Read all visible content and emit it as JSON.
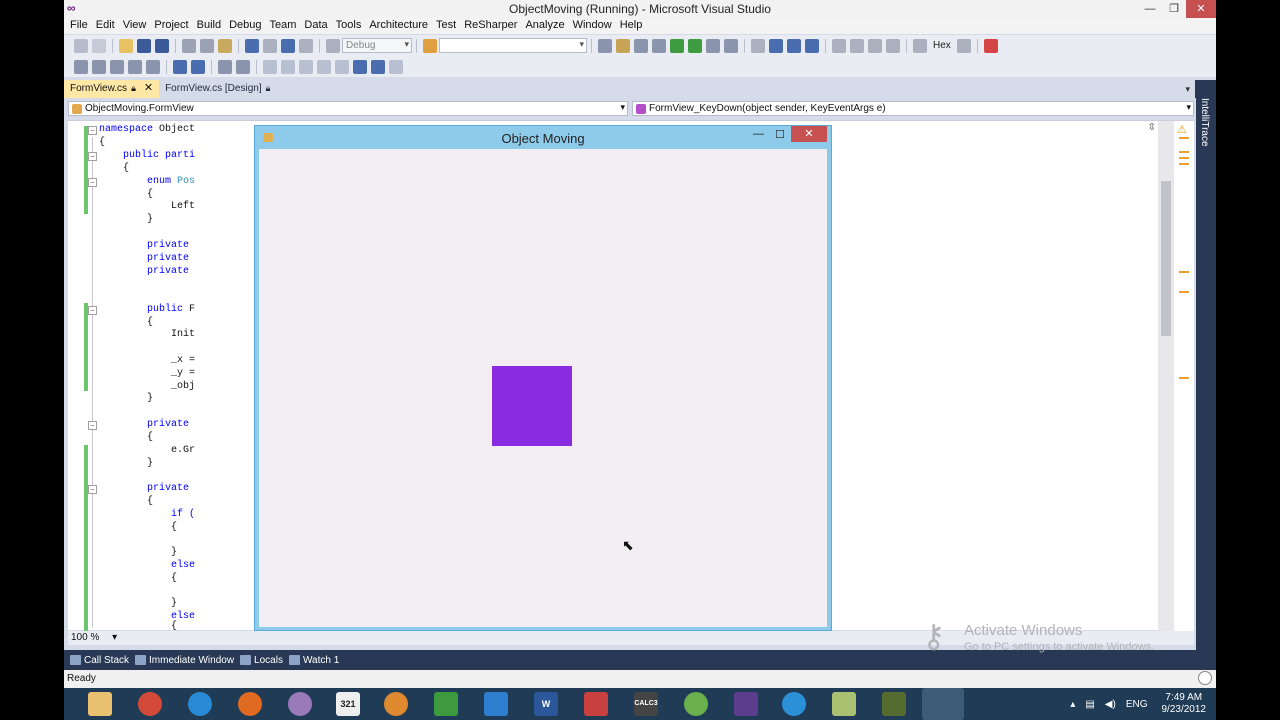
{
  "window": {
    "title": "ObjectMoving (Running) - Microsoft Visual Studio"
  },
  "menu": [
    "File",
    "Edit",
    "View",
    "Project",
    "Build",
    "Debug",
    "Team",
    "Data",
    "Tools",
    "Architecture",
    "Test",
    "ReSharper",
    "Analyze",
    "Window",
    "Help"
  ],
  "toolbar": {
    "config_combo": "Debug",
    "platform_combo": "",
    "hex_label": "Hex"
  },
  "tabs": {
    "active": "FormView.cs",
    "inactive": "FormView.cs [Design]"
  },
  "navbar": {
    "class_combo": "ObjectMoving.FormView",
    "member_combo": "FormView_KeyDown(object sender, KeyEventArgs e)"
  },
  "code": {
    "l1": "namespace Object",
    "l2": "{",
    "l3": "    public parti",
    "l4": "    {",
    "l5": "        enum Pos",
    "l6": "        {",
    "l7": "            Left",
    "l8": "        }",
    "l9": "        private",
    "l10": "        private",
    "l11": "        private",
    "l12": "        public F",
    "l13": "        {",
    "l14": "            Init",
    "l15": "            _x =",
    "l16": "            _y =",
    "l17": "            _obj",
    "l18": "        }",
    "l19": "        private",
    "l20": "        {",
    "l21": "            e.Gr",
    "l22": "        }",
    "l23": "        private",
    "l24": "        {",
    "l25": "            if (",
    "l26": "            {",
    "l27": "            }",
    "l28": "            else",
    "l29": "            {",
    "l30": "            }",
    "l31": "            else",
    "l32": "            {"
  },
  "zoom": "100 %",
  "side_panel": {
    "label": "IntelliTrace"
  },
  "tool_tabs": [
    "Call Stack",
    "Immediate Window",
    "Locals",
    "Watch 1"
  ],
  "status": {
    "text": "Ready"
  },
  "form": {
    "title": "Object Moving",
    "object_color": "#8a2be2"
  },
  "watermark": {
    "title": "Activate Windows",
    "subtitle": "Go to PC settings to activate Windows."
  },
  "tray": {
    "language": "ENG",
    "time": "7:49 AM",
    "date": "9/23/2012"
  },
  "taskbar": {
    "calendar_label": "321",
    "calc_label": "CALC3"
  }
}
